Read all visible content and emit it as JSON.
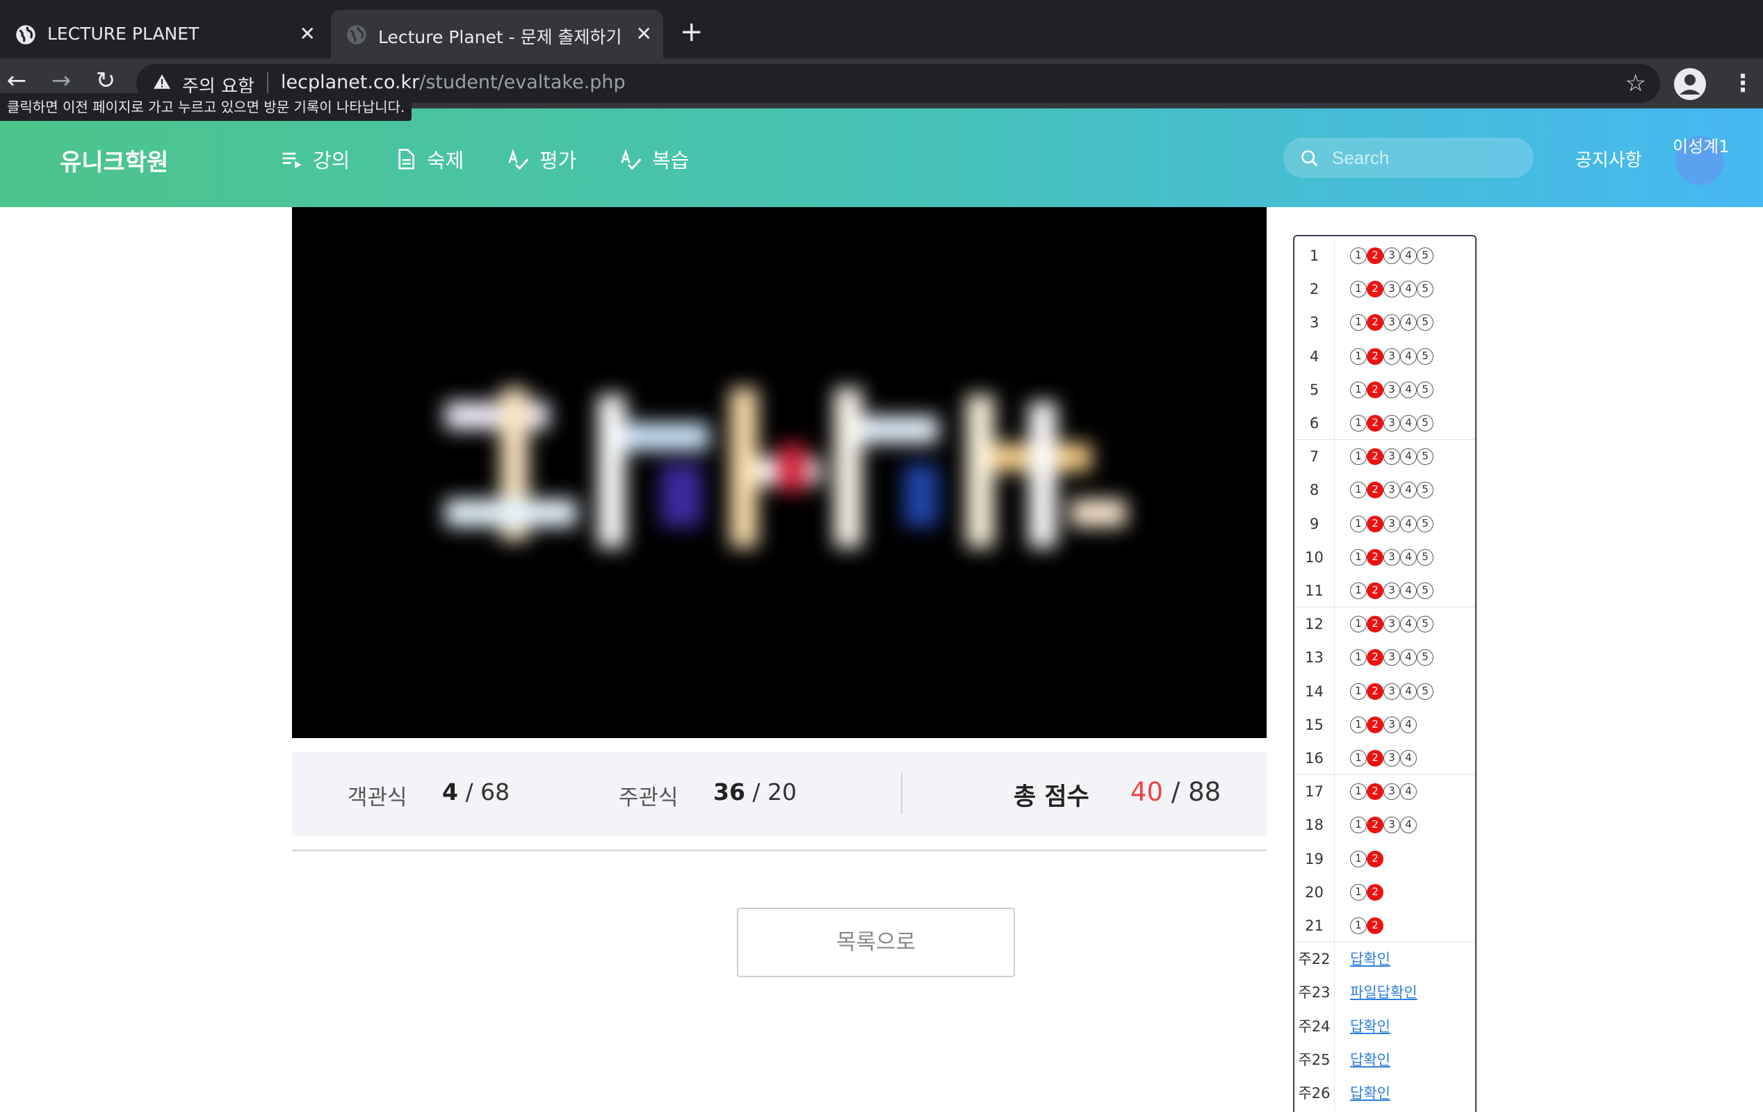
{
  "browser": {
    "tabs": [
      {
        "title": "LECTURE PLANET",
        "active": false
      },
      {
        "title": "Lecture Planet - 문제 출제하기",
        "active": true
      }
    ],
    "security_warning": "주의 요함",
    "url_host": "lecplanet.co.kr",
    "url_path": "/student/evaltake.php",
    "back_tooltip": "클릭하면 이전 페이지로 가고 누르고 있으면 방문 기록이 나타납니다."
  },
  "header": {
    "brand": "유니크학원",
    "menu": [
      {
        "label": "강의",
        "icon": "playlist-icon"
      },
      {
        "label": "숙제",
        "icon": "document-icon"
      },
      {
        "label": "평가",
        "icon": "spellcheck-icon"
      },
      {
        "label": "복습",
        "icon": "spellcheck-icon"
      }
    ],
    "search_placeholder": "Search",
    "notice": "공지사항",
    "user_name": "이성계1"
  },
  "score": {
    "objective_label": "객관식",
    "objective_score": "4",
    "objective_total": "68",
    "subjective_label": "주관식",
    "subjective_score": "36",
    "subjective_total": "20",
    "total_label": "총 점수",
    "total_score": "40",
    "total_max": "88"
  },
  "list_button": "목록으로",
  "answers": {
    "selected_color": "#ee1111",
    "objective": [
      {
        "num": "1",
        "options": 5,
        "selected": 2
      },
      {
        "num": "2",
        "options": 5,
        "selected": 2
      },
      {
        "num": "3",
        "options": 5,
        "selected": 2
      },
      {
        "num": "4",
        "options": 5,
        "selected": 2
      },
      {
        "num": "5",
        "options": 5,
        "selected": 2
      },
      {
        "num": "6",
        "options": 5,
        "selected": 2
      },
      {
        "num": "7",
        "options": 5,
        "selected": 2
      },
      {
        "num": "8",
        "options": 5,
        "selected": 2
      },
      {
        "num": "9",
        "options": 5,
        "selected": 2
      },
      {
        "num": "10",
        "options": 5,
        "selected": 2
      },
      {
        "num": "11",
        "options": 5,
        "selected": 2
      },
      {
        "num": "12",
        "options": 5,
        "selected": 2
      },
      {
        "num": "13",
        "options": 5,
        "selected": 2
      },
      {
        "num": "14",
        "options": 5,
        "selected": 2
      },
      {
        "num": "15",
        "options": 4,
        "selected": 2
      },
      {
        "num": "16",
        "options": 4,
        "selected": 2
      },
      {
        "num": "17",
        "options": 4,
        "selected": 2
      },
      {
        "num": "18",
        "options": 4,
        "selected": 2
      },
      {
        "num": "19",
        "options": 2,
        "selected": 2
      },
      {
        "num": "20",
        "options": 2,
        "selected": 2
      },
      {
        "num": "21",
        "options": 2,
        "selected": 2
      }
    ],
    "subjective": [
      {
        "num": "주22",
        "link": "답확인"
      },
      {
        "num": "주23",
        "link": "파일답확인"
      },
      {
        "num": "주24",
        "link": "답확인"
      },
      {
        "num": "주25",
        "link": "답확인"
      },
      {
        "num": "주26",
        "link": "답확인"
      }
    ]
  }
}
